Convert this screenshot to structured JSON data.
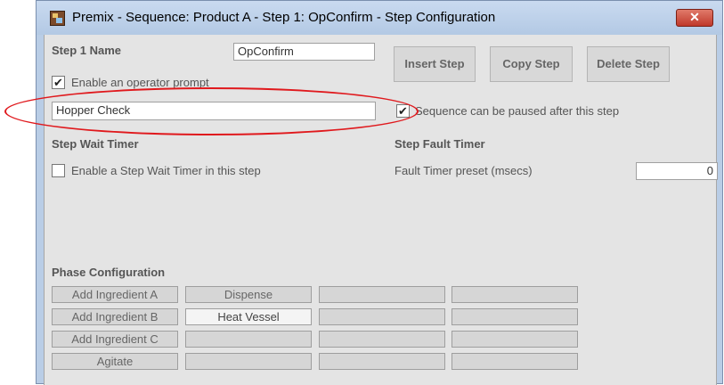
{
  "window": {
    "title": "Premix - Sequence: Product A - Step 1: OpConfirm - Step Configuration",
    "close_label": "✕"
  },
  "step": {
    "name_label": "Step 1 Name",
    "name_value": "OpConfirm",
    "enable_prompt_label": "Enable an operator prompt",
    "enable_prompt_checked": true,
    "prompt_value": "Hopper Check",
    "pause_label": "Sequence can be paused after this step",
    "pause_checked": true
  },
  "toolbar": {
    "insert_label": "Insert Step",
    "copy_label": "Copy Step",
    "delete_label": "Delete Step"
  },
  "wait_timer": {
    "heading": "Step Wait Timer",
    "enable_label": "Enable a Step Wait Timer in this step",
    "enable_checked": false
  },
  "fault_timer": {
    "heading": "Step Fault Timer",
    "preset_label": "Fault Timer preset (msecs)",
    "preset_value": "0"
  },
  "phase_config": {
    "heading": "Phase Configuration",
    "rows": [
      [
        "Add Ingredient A",
        "Dispense",
        "",
        ""
      ],
      [
        "Add Ingredient B",
        "Heat Vessel",
        "",
        ""
      ],
      [
        "Add Ingredient C",
        "",
        "",
        ""
      ],
      [
        "Agitate",
        "",
        "",
        ""
      ]
    ],
    "selected_cell": [
      1,
      1
    ]
  },
  "colors": {
    "highlight": "#e0191d",
    "close_button": "#c0392b"
  }
}
